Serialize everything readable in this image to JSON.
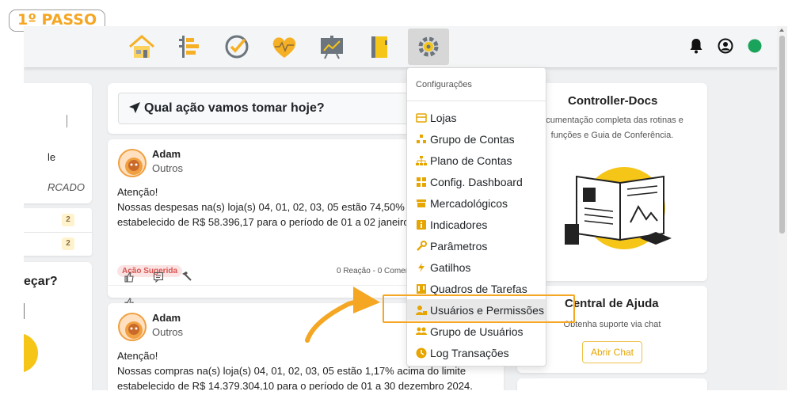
{
  "step_label": "1º PASSO",
  "nav": {
    "icons": [
      "home-icon",
      "timeline-icon",
      "check-circle-icon",
      "heart-pulse-icon",
      "chart-board-icon",
      "notebook-icon",
      "gear-icon"
    ],
    "active": "gear-icon"
  },
  "topbar_right": {
    "icons": [
      "bell-icon",
      "user-circle-icon",
      "status-dot-icon"
    ],
    "status_color": "#1aa35a"
  },
  "left_panel": {
    "text_1": "le",
    "text_2": "RCADO",
    "badges": [
      "2",
      "2"
    ],
    "prompt": "eçar?"
  },
  "feed": {
    "ask_title": "Qual ação vamos tomar hoje?",
    "posts": [
      {
        "author": "Adam",
        "category": "Outros",
        "lines": [
          "Atenção!",
          "Nossas despesas na(s) loja(s) 04, 01, 02, 03, 05 estão 74,50% acima",
          "estabelecido de R$ 58.396,17 para o período de 01 a 02 janeiro 20"
        ],
        "tag": "Ação Sugerida",
        "meta": "0 Reação - 0 Coment"
      },
      {
        "author": "Adam",
        "category": "Outros",
        "lines": [
          "Atenção!",
          "Nossas compras na(s) loja(s) 04, 01, 02, 03, 05 estão 1,17% acima do limite",
          "estabelecido de R$ 14.379.304,10 para o período de 01 a 30 dezembro 2024."
        ]
      }
    ]
  },
  "menu": {
    "header": "Configurações",
    "items": [
      {
        "label": "Lojas",
        "icon": "store-icon"
      },
      {
        "label": "Grupo de Contas",
        "icon": "account-group-icon"
      },
      {
        "label": "Plano de Contas",
        "icon": "hierarchy-icon"
      },
      {
        "label": "Config. Dashboard",
        "icon": "dashboard-grid-icon"
      },
      {
        "label": "Mercadológicos",
        "icon": "folder-icon"
      },
      {
        "label": "Indicadores",
        "icon": "info-square-icon"
      },
      {
        "label": "Parâmetros",
        "icon": "wrench-icon"
      },
      {
        "label": "Gatilhos",
        "icon": "lightning-icon"
      },
      {
        "label": "Quadros de Tarefas",
        "icon": "kanban-icon"
      },
      {
        "label": "Usuários e Permissões",
        "icon": "user-lock-icon"
      },
      {
        "label": "Grupo de Usuários",
        "icon": "users-icon"
      },
      {
        "label": "Log Transações",
        "icon": "clock-icon"
      }
    ],
    "highlighted": "Usuários e Permissões"
  },
  "controller_docs": {
    "title": "Controller-Docs",
    "desc_line1": "ocumentação completa das rotinas e",
    "desc_line2": "funções e Guia de Conferência."
  },
  "help_center": {
    "title": "Central de Ajuda",
    "subtitle": "Obtenha suporte via chat",
    "button": "Abrir Chat"
  },
  "colors": {
    "accent": "#f5a623",
    "brand_yellow": "#f5c518",
    "danger": "#d9534f"
  }
}
